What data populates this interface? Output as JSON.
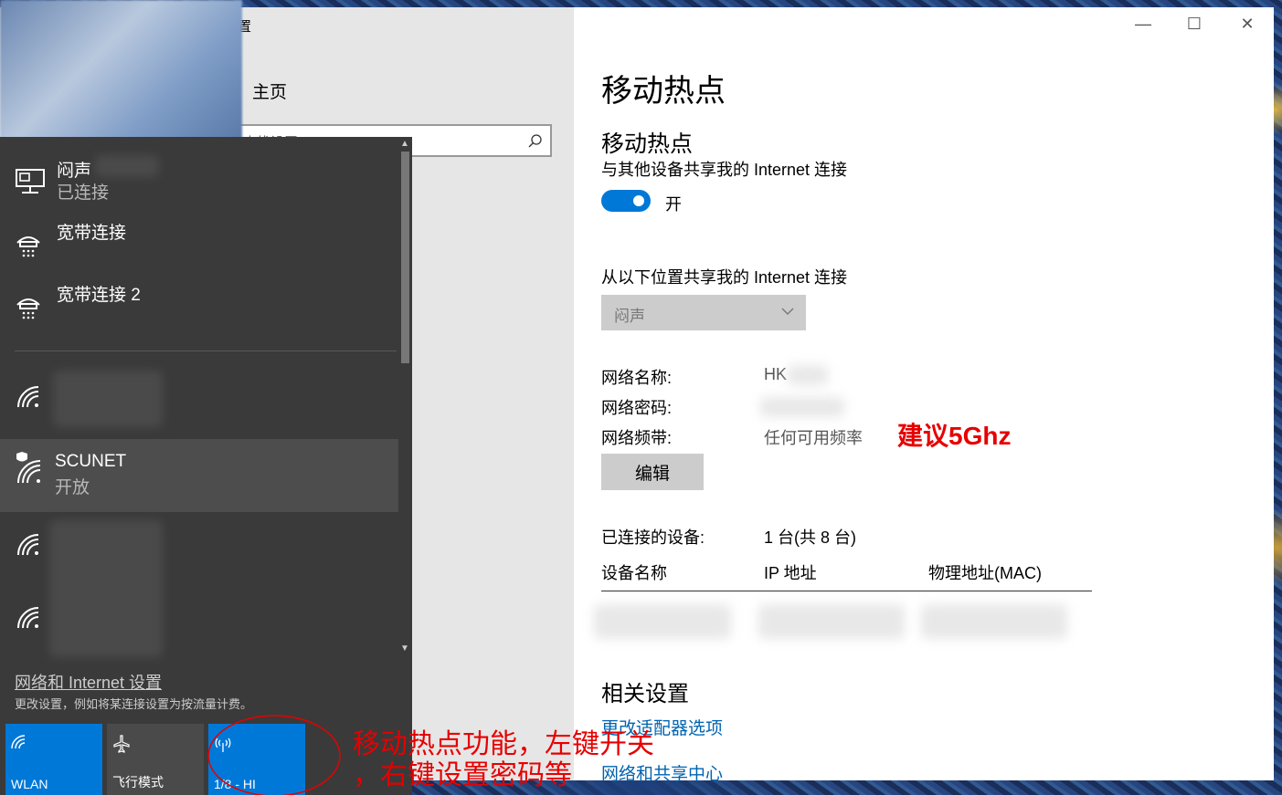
{
  "window": {
    "title_fragment": "置",
    "home_label": "主页",
    "search_placeholder": "查找设置",
    "controls": {
      "minimize": "—",
      "maximize": "☐",
      "close": "✕"
    }
  },
  "hotspot": {
    "page_title": "移动热点",
    "section_title": "移动热点",
    "share_desc": "与其他设备共享我的 Internet 连接",
    "toggle_state": "开",
    "share_from_label": "从以下位置共享我的 Internet 连接",
    "share_from_value": "闷声",
    "fields": [
      {
        "label": "网络名称:",
        "value": "HK"
      },
      {
        "label": "网络密码:",
        "value": ""
      },
      {
        "label": "网络频带:",
        "value": "任何可用频率"
      }
    ],
    "edit_button": "编辑",
    "connected_label": "已连接的设备:",
    "connected_value": "1 台(共 8 台)",
    "table_headers": [
      "设备名称",
      "IP 地址",
      "物理地址(MAC)"
    ],
    "related_title": "相关设置",
    "related_links": [
      "更改适配器选项",
      "网络和共享中心"
    ]
  },
  "annotations": {
    "band_tip": "建议5Ghz",
    "tile_tip_line1": "移动热点功能，左键开关",
    "tile_tip_line2": "，右键设置密码等"
  },
  "flyout": {
    "networks": [
      {
        "name": "闷声",
        "status": "已连接",
        "icon": "ethernet-icon"
      },
      {
        "name": "宽带连接",
        "status": "",
        "icon": "dialup-icon"
      },
      {
        "name": "宽带连接 2",
        "status": "",
        "icon": "dialup-icon"
      },
      {
        "name": "",
        "status": "",
        "icon": "wifi-icon"
      },
      {
        "name": "SCUNET",
        "status": "开放",
        "icon": "wifi-shield-icon"
      },
      {
        "name": "",
        "status": "",
        "icon": "wifi-icon"
      },
      {
        "name": "",
        "status": "",
        "icon": "wifi-icon"
      }
    ],
    "settings_link": "网络和 Internet 设置",
    "settings_sub": "更改设置，例如将某连接设置为按流量计费。",
    "tiles": [
      {
        "label": "WLAN",
        "active": true,
        "icon": "wifi-icon"
      },
      {
        "label": "飞行模式",
        "active": false,
        "icon": "airplane-icon"
      },
      {
        "label": "1/8 - HI",
        "active": true,
        "icon": "hotspot-icon"
      }
    ]
  },
  "colors": {
    "accent": "#0078d7",
    "link": "#0063b1",
    "annotation": "#e60000"
  }
}
